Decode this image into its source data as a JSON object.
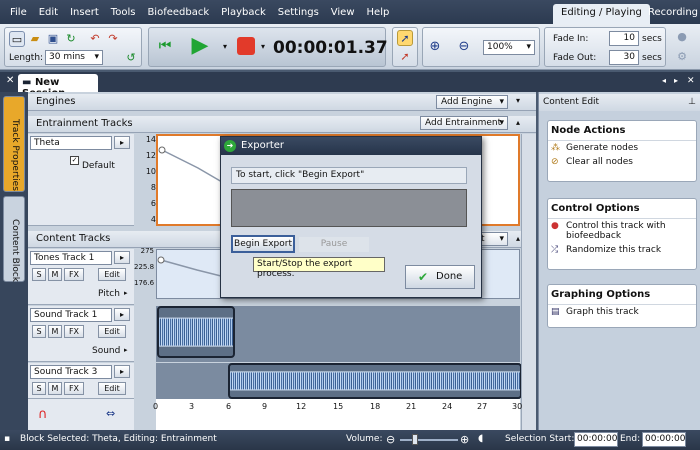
{
  "menu": {
    "items": [
      "File",
      "Edit",
      "Insert",
      "Tools",
      "Biofeedback",
      "Playback",
      "Settings",
      "View",
      "Help"
    ],
    "tabs": [
      "Editing / Playing",
      "Recording"
    ]
  },
  "toolbar": {
    "length_label": "Length:",
    "length_value": "30 mins",
    "time": "00:00:01.37",
    "zoom": "100%",
    "fade_in_label": "Fade In:",
    "fade_in_value": "10",
    "fade_out_label": "Fade Out:",
    "fade_out_value": "30",
    "secs": "secs"
  },
  "doc": {
    "tab_title": "New Session"
  },
  "side_tabs": [
    "Track Properties",
    "Content Block"
  ],
  "engines": {
    "title": "Engines",
    "add_button": "Add Engine"
  },
  "entrainment": {
    "title": "Entrainment Tracks",
    "add_button": "Add Entrainment",
    "track_name": "Theta",
    "default_label": "Default",
    "y_ticks": [
      "14",
      "12",
      "10",
      "8",
      "6",
      "4"
    ]
  },
  "content": {
    "title": "Content Tracks",
    "add_button_partial": "t",
    "tracks": [
      {
        "name": "Tones Track 1",
        "sub": "Pitch",
        "s": "S",
        "m": "M",
        "fx": "FX",
        "edit": "Edit",
        "y_ticks": [
          "275",
          "225.8",
          "176.6"
        ]
      },
      {
        "name": "Sound Track 1",
        "sub": "Sound",
        "s": "S",
        "m": "M",
        "fx": "FX",
        "edit": "Edit"
      },
      {
        "name": "Sound Track 3",
        "s": "S",
        "m": "M",
        "fx": "FX",
        "edit": "Edit"
      }
    ],
    "timeline": [
      "0",
      "3",
      "6",
      "9",
      "12",
      "15",
      "18",
      "21",
      "24",
      "27",
      "30"
    ]
  },
  "right_panel": {
    "title": "Content Edit",
    "node_actions": {
      "title": "Node Actions",
      "items": [
        "Generate nodes",
        "Clear all nodes"
      ]
    },
    "control_options": {
      "title": "Control Options",
      "items": [
        "Control this track with biofeedback",
        "Randomize this track"
      ]
    },
    "graphing_options": {
      "title": "Graphing Options",
      "items": [
        "Graph this track"
      ]
    }
  },
  "dialog": {
    "title": "Exporter",
    "message": "To start, click \"Begin Export\"",
    "begin_button": "Begin Export",
    "pause_button": "Pause",
    "done_button": "Done",
    "tooltip": "Start/Stop the export process."
  },
  "status": {
    "text": "Block Selected: Theta, Editing: Entrainment",
    "volume_label": "Volume:",
    "selection_start_label": "Selection Start:",
    "selection_start": "00:00:00",
    "end_label": "End:",
    "end": "00:00:00"
  }
}
